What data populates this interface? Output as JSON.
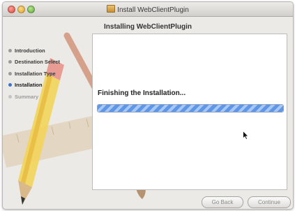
{
  "window": {
    "title": "Install WebClientPlugin",
    "subtitle": "Installing WebClientPlugin"
  },
  "steps": [
    {
      "label": "Introduction",
      "state": "done"
    },
    {
      "label": "Destination Select",
      "state": "done"
    },
    {
      "label": "Installation Type",
      "state": "done"
    },
    {
      "label": "Installation",
      "state": "current"
    },
    {
      "label": "Summary",
      "state": "pending"
    }
  ],
  "main": {
    "status": "Finishing the Installation...",
    "progress": 1.0
  },
  "buttons": {
    "back": "Go Back",
    "continue": "Continue"
  },
  "icons": {
    "title": "package-icon",
    "pointer": "arrow-cursor-icon"
  },
  "colors": {
    "accent": "#3d73c9",
    "progress": "#5f97e6"
  }
}
